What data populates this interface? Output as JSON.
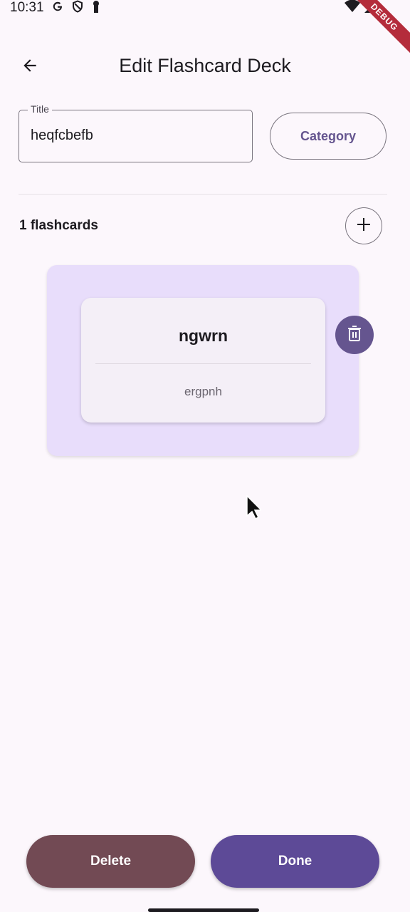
{
  "status_bar": {
    "time": "10:31",
    "left_icons": [
      "google-icon",
      "shield-icon",
      "keyhole-icon"
    ],
    "right_icons": [
      "wifi-icon",
      "signal-icon"
    ],
    "debug_label": "DEBUG"
  },
  "app_bar": {
    "back_icon": "arrow-back-icon",
    "title": "Edit Flashcard Deck"
  },
  "form": {
    "title_label": "Title",
    "title_value": "heqfcbefb",
    "category_label": "Category"
  },
  "flashcards": {
    "count_label": "1 flashcards",
    "add_icon": "plus-icon",
    "items": [
      {
        "front": "ngwrn",
        "back": "ergpnh",
        "delete_icon": "trash-icon"
      }
    ]
  },
  "footer": {
    "delete_label": "Delete",
    "done_label": "Done"
  },
  "colors": {
    "background": "#fcf7fc",
    "primary": "#65558f",
    "delete_button": "#724a54",
    "done_button": "#5d4a97",
    "card_outer": "#e8ddfb",
    "card_inner": "#f4eff7"
  }
}
